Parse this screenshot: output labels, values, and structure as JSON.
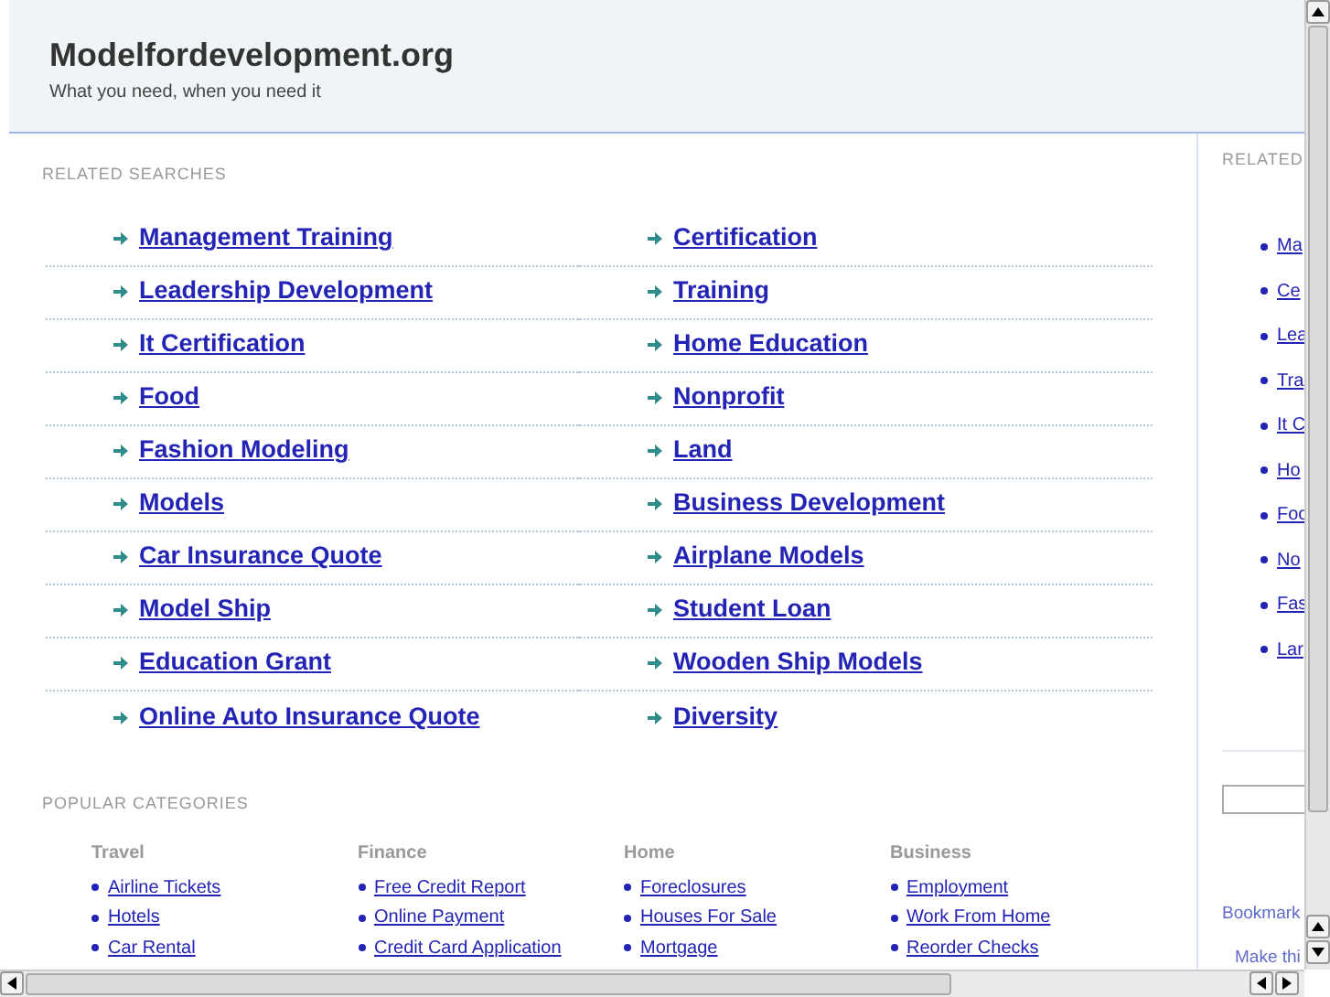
{
  "header": {
    "title": "Modelfordevelopment.org",
    "tagline": "What you need, when you need it"
  },
  "related_searches": {
    "heading": "RELATED SEARCHES",
    "items": [
      "Management Training",
      "Certification",
      "Leadership Development",
      "Training",
      "It Certification",
      "Home Education",
      "Food",
      "Nonprofit",
      "Fashion Modeling",
      "Land",
      "Models",
      "Business Development",
      "Car Insurance Quote",
      "Airplane Models",
      "Model Ship",
      "Student Loan",
      "Education Grant",
      "Wooden Ship Models",
      "Online Auto Insurance Quote",
      "Diversity"
    ]
  },
  "popular_categories": {
    "heading": "POPULAR CATEGORIES",
    "groups": [
      {
        "title": "Travel",
        "links": [
          "Airline Tickets",
          "Hotels",
          "Car Rental"
        ]
      },
      {
        "title": "Finance",
        "links": [
          "Free Credit Report",
          "Online Payment",
          "Credit Card Application"
        ]
      },
      {
        "title": "Home",
        "links": [
          "Foreclosures",
          "Houses For Sale",
          "Mortgage"
        ]
      },
      {
        "title": "Business",
        "links": [
          "Employment",
          "Work From Home",
          "Reorder Checks"
        ]
      }
    ]
  },
  "sidebar": {
    "heading": "RELATED",
    "links": [
      "Ma",
      "Ce",
      "Lea",
      "Tra",
      "It C",
      "Ho",
      "Foo",
      "No",
      "Fas",
      "Lar"
    ],
    "bookmark_links": [
      "Bookmark",
      "Make thi"
    ]
  }
}
